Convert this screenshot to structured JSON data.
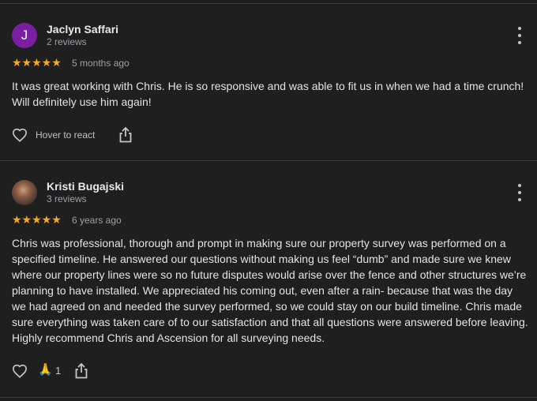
{
  "reviews": [
    {
      "avatar_letter": "J",
      "avatar_color": "#7b1fa2",
      "name": "Jaclyn Saffari",
      "review_count": "2 reviews",
      "rating": 5,
      "stars": "★★★★★",
      "time": "5 months ago",
      "text": "It was great working with Chris. He is so responsive and was able to fit us in when we had a time crunch! Will definitely use him again!",
      "react_label": "Hover to react",
      "like_icon": "heart-outline-icon",
      "share_icon": "share-icon",
      "more_icon": "more-vertical-icon"
    },
    {
      "avatar_letter": "",
      "name": "Kristi Bugajski",
      "review_count": "3 reviews",
      "rating": 5,
      "stars": "★★★★★",
      "time": "6 years ago",
      "text": "Chris was professional, thorough and prompt in making sure our property survey was performed on a specified timeline. He answered our questions without making us feel “dumb” and made sure we knew where our property lines were so no future disputes would arise over the fence and other structures we’re planning to have installed. We appreciated his coming out, even after a rain- because that was the day we had agreed on and needed the survey performed, so we could stay on our build timeline. Chris made sure everything was taken care of to our satisfaction and that all questions were answered before leaving. Highly recommend Chris and Ascension for all surveying needs.",
      "reaction_emoji": "🙏",
      "reaction_count": "1",
      "like_icon": "heart-outline-icon",
      "share_icon": "share-icon",
      "more_icon": "more-vertical-icon"
    }
  ],
  "colors": {
    "background": "#1f1f1f",
    "star": "#f9a825",
    "divider": "#3c3c3c"
  }
}
